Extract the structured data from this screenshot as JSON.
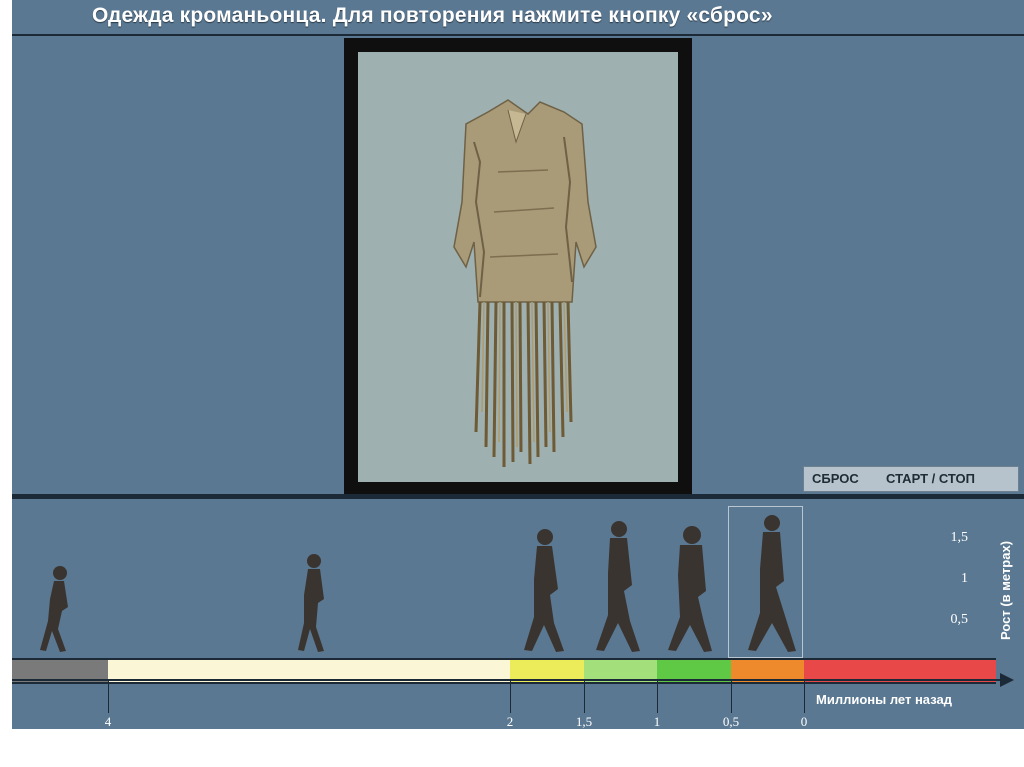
{
  "title": "Одежда кроманьонца. Для повторения нажмите кнопку «сброс»",
  "controls": {
    "reset_label": "СБРОС",
    "start_stop_label": "СТАРТ / СТОП"
  },
  "height_scale": {
    "title": "Рост (в метрах)",
    "labels": [
      "1,5",
      "1",
      "0,5"
    ]
  },
  "timeline": {
    "axis_title": "Миллионы лет назад",
    "tick_labels": [
      "4",
      "2",
      "1,5",
      "1",
      "0,5",
      "0"
    ],
    "segment_colors": [
      "#7a7a7a",
      "#fbf7d6",
      "#ecec5a",
      "#a3e07c",
      "#5fc845",
      "#ef8a2c",
      "#e84848"
    ]
  },
  "figures": [
    {
      "icon": "australopithecus-figure-icon"
    },
    {
      "icon": "hominid-figure-icon"
    },
    {
      "icon": "homo-habilis-figure-icon"
    },
    {
      "icon": "homo-erectus-figure-icon"
    },
    {
      "icon": "neanderthal-figure-icon"
    },
    {
      "icon": "cro-magnon-figure-icon",
      "selected": true
    }
  ],
  "colors": {
    "panel": "#5a7891",
    "dark": "#1b2a36",
    "photo_bg": "#9eb0b0"
  }
}
